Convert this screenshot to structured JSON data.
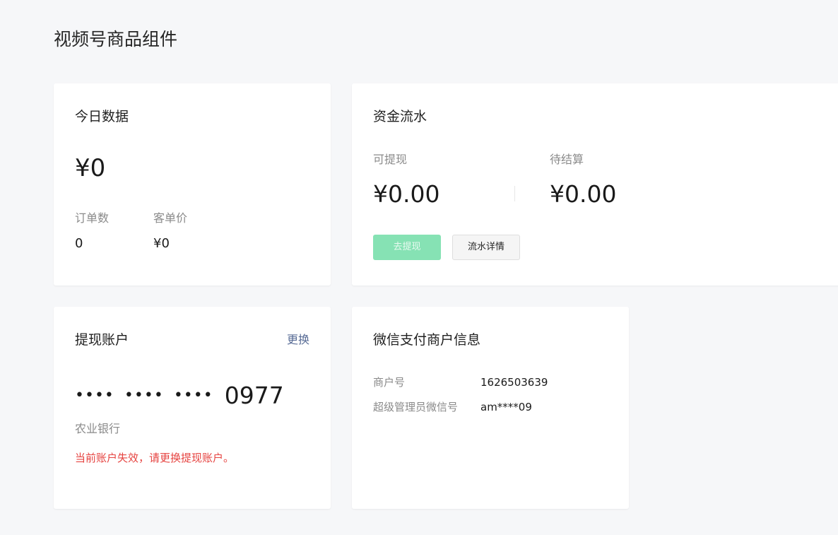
{
  "page": {
    "title": "视频号商品组件"
  },
  "today": {
    "title": "今日数据",
    "amount": "¥0",
    "orders_label": "订单数",
    "orders_value": "0",
    "avg_label": "客单价",
    "avg_value": "¥0"
  },
  "funds": {
    "title": "资金流水",
    "withdrawable_label": "可提现",
    "withdrawable_value": "¥0.00",
    "pending_label": "待结算",
    "pending_value": "¥0.00",
    "withdraw_button": "去提现",
    "details_button": "流水详情"
  },
  "account": {
    "title": "提现账户",
    "change_link": "更换",
    "masked_groups": [
      "••••",
      "••••",
      "••••"
    ],
    "last4": "0977",
    "bank": "农业银行",
    "warning": "当前账户失效，请更换提现账户。"
  },
  "merchant": {
    "title": "微信支付商户信息",
    "id_label": "商户号",
    "id_value": "1626503639",
    "admin_label": "超级管理员微信号",
    "admin_value": "am****09"
  },
  "colors": {
    "background": "#f6f7f9",
    "primary_disabled": "#86e2b4",
    "link": "#576b95",
    "warning": "#e64340"
  }
}
